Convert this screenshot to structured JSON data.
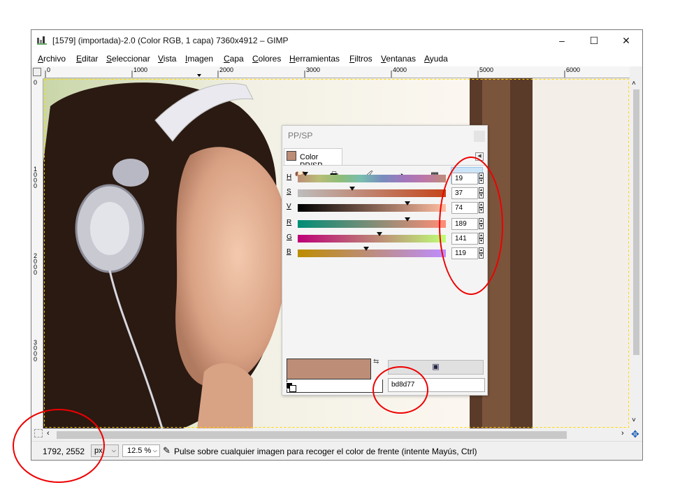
{
  "window": {
    "title": "[1579] (importada)-2.0 (Color RGB, 1 capa) 7360x4912 – GIMP",
    "minimize_glyph": "–",
    "maximize_glyph": "☐",
    "close_glyph": "✕"
  },
  "menu": [
    "Archivo",
    "Editar",
    "Seleccionar",
    "Vista",
    "Imagen",
    "Capa",
    "Colores",
    "Herramientas",
    "Filtros",
    "Ventanas",
    "Ayuda"
  ],
  "ruler_top": [
    "0",
    "1000",
    "2000",
    "3000",
    "4000",
    "5000",
    "6000"
  ],
  "ruler_left": [
    "0",
    "1000",
    "2000",
    "3000"
  ],
  "statusbar": {
    "coords": "1792, 2552",
    "unit": "px",
    "zoom": "12.5 %",
    "message": "Pulse sobre cualquier imagen para recoger el color de frente (intente Mayús, Ctrl)"
  },
  "dock": {
    "title": "PP/SP",
    "tab_label": "Color PP/SP",
    "selector_icons": [
      "gimp-wilber-icon",
      "printer-cmyk-icon",
      "watercolor-brush-icon",
      "color-wheel-icon",
      "palette-icon",
      "scales-icon"
    ],
    "channels": [
      {
        "key": "H",
        "value": "19",
        "marker": 0.05
      },
      {
        "key": "S",
        "value": "37",
        "marker": 0.37
      },
      {
        "key": "V",
        "value": "74",
        "marker": 0.74
      },
      {
        "key": "R",
        "value": "189",
        "marker": 0.74
      },
      {
        "key": "G",
        "value": "141",
        "marker": 0.55
      },
      {
        "key": "B",
        "value": "119",
        "marker": 0.46
      }
    ],
    "hex": "bd8d77",
    "fg_color": "#bd8d77"
  },
  "colors": {
    "annotation_red": "#e00000",
    "active_selector": "#cce4f7"
  }
}
